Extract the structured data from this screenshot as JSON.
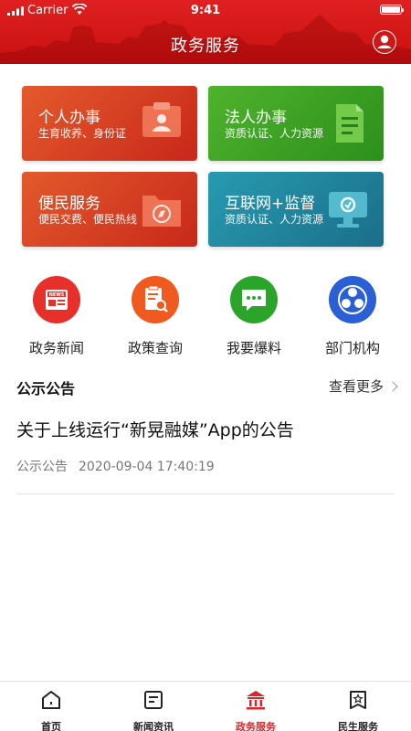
{
  "status_bar": {
    "carrier": "Carrier",
    "time": "9:41"
  },
  "header": {
    "title": "政务服务"
  },
  "cards": [
    {
      "title": "个人办事",
      "subtitle": "生育收养、身份证",
      "icon": "id-card-icon",
      "color": "#d9422a"
    },
    {
      "title": "法人办事",
      "subtitle": "资质认证、人力资源",
      "icon": "document-icon",
      "color": "#3ea226"
    },
    {
      "title": "便民服务",
      "subtitle": "便民交费、便民热线",
      "icon": "folder-compass-icon",
      "color": "#d6402a"
    },
    {
      "title": "互联网+监督",
      "subtitle": "资质认证、人力资源",
      "icon": "monitor-icon",
      "color": "#2385a0"
    }
  ],
  "quick_links": [
    {
      "label": "政务新闻",
      "icon": "news-icon",
      "color": "#e8302a"
    },
    {
      "label": "政策查询",
      "icon": "policy-search-icon",
      "color": "#f05a1e"
    },
    {
      "label": "我要爆料",
      "icon": "chat-bubble-icon",
      "color": "#2aa52a"
    },
    {
      "label": "部门机构",
      "icon": "organization-icon",
      "color": "#2a5fd6"
    }
  ],
  "notice": {
    "section_title": "公示公告",
    "more_label": "查看更多",
    "items": [
      {
        "title": "关于上线运行“新晃融媒”App的公告",
        "category": "公示公告",
        "datetime": "2020-09-04 17:40:19"
      }
    ]
  },
  "tabbar": {
    "items": [
      {
        "label": "首页",
        "icon": "home-icon",
        "active": false
      },
      {
        "label": "新闻资讯",
        "icon": "news-list-icon",
        "active": false
      },
      {
        "label": "政务服务",
        "icon": "government-building-icon",
        "active": true
      },
      {
        "label": "民生服务",
        "icon": "star-badge-icon",
        "active": false
      }
    ],
    "active_color": "#d8262a"
  }
}
